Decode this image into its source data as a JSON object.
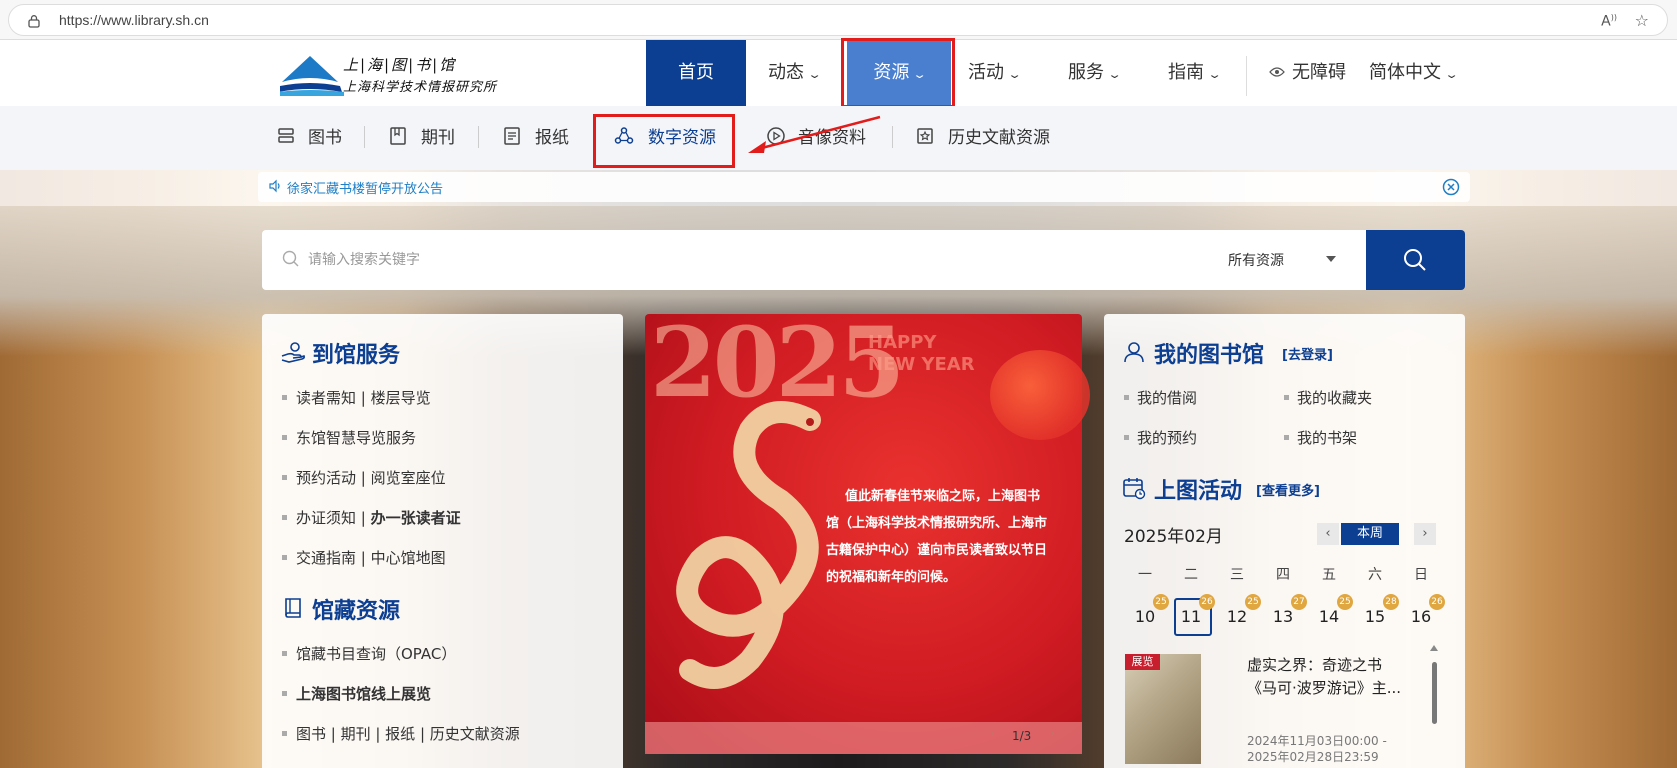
{
  "browser": {
    "url": "https://www.library.sh.cn"
  },
  "header": {
    "logo_line1": "上|海|图|书|馆",
    "logo_line2": "上海科学技术情报研究所",
    "nav": [
      {
        "label": "首页"
      },
      {
        "label": "动态"
      },
      {
        "label": "资源"
      },
      {
        "label": "活动"
      },
      {
        "label": "服务"
      },
      {
        "label": "指南"
      }
    ],
    "accessibility": "无障碍",
    "language": "简体中文"
  },
  "subnav": {
    "items": [
      {
        "label": "图书",
        "icon": "book-stack-icon"
      },
      {
        "label": "期刊",
        "icon": "journal-icon"
      },
      {
        "label": "报纸",
        "icon": "newspaper-icon"
      },
      {
        "label": "数字资源",
        "icon": "digital-resource-icon"
      },
      {
        "label": "音像资料",
        "icon": "play-icon"
      },
      {
        "label": "历史文献资源",
        "icon": "history-document-icon"
      }
    ]
  },
  "notice": {
    "text": "徐家汇藏书楼暂停开放公告"
  },
  "search": {
    "placeholder": "请输入搜索关键字",
    "scope": "所有资源"
  },
  "left_panel": {
    "arrival_title": "到馆服务",
    "arrival_items": [
      {
        "label": "读者需知 | 楼层导览"
      },
      {
        "label": "东馆智慧导览服务"
      },
      {
        "label": "预约活动 | 阅览室座位"
      },
      {
        "label_a": "办证须知 | ",
        "label_b": "办一张读者证"
      },
      {
        "label": "交通指南 | 中心馆地图"
      }
    ],
    "collection_title": "馆藏资源",
    "collection_items": [
      {
        "label": "馆藏书目查询（OPAC）"
      },
      {
        "label": "上海图书馆线上展览"
      },
      {
        "label": "图书 | 期刊 | 报纸 | 历史文献资源"
      }
    ]
  },
  "banner": {
    "year": "2025",
    "happy": "HAPPY",
    "new_year": "NEW YEAR",
    "lines": [
      "值此新春佳节来临之际，上海图书",
      "馆（上海科学技术情报研究所、上海市",
      "古籍保护中心）谨向市民读者致以节日",
      "的祝福和新年的问候。"
    ],
    "pager": "1/3"
  },
  "right_panel": {
    "mylib_title": "我的图书馆",
    "login": "[去登录]",
    "mylib_items": [
      {
        "label": "我的借阅"
      },
      {
        "label": "我的收藏夹"
      },
      {
        "label": "我的预约"
      },
      {
        "label": "我的书架"
      }
    ],
    "events_title": "上图活动",
    "more": "[查看更多]",
    "month": "2025年02月",
    "week_label": "本周",
    "weekdays": [
      "一",
      "二",
      "三",
      "四",
      "五",
      "六",
      "日"
    ],
    "days": [
      {
        "day": "10",
        "badge": "25"
      },
      {
        "day": "11",
        "badge": "26"
      },
      {
        "day": "12",
        "badge": "25"
      },
      {
        "day": "13",
        "badge": "27"
      },
      {
        "day": "14",
        "badge": "25"
      },
      {
        "day": "15",
        "badge": "28"
      },
      {
        "day": "16",
        "badge": "26"
      }
    ],
    "event": {
      "tag": "展览",
      "title": "虚实之界：奇迹之书《马可·波罗游记》主...",
      "time": "2024年11月03日00:00 - 2025年02月28日23:59"
    }
  }
}
